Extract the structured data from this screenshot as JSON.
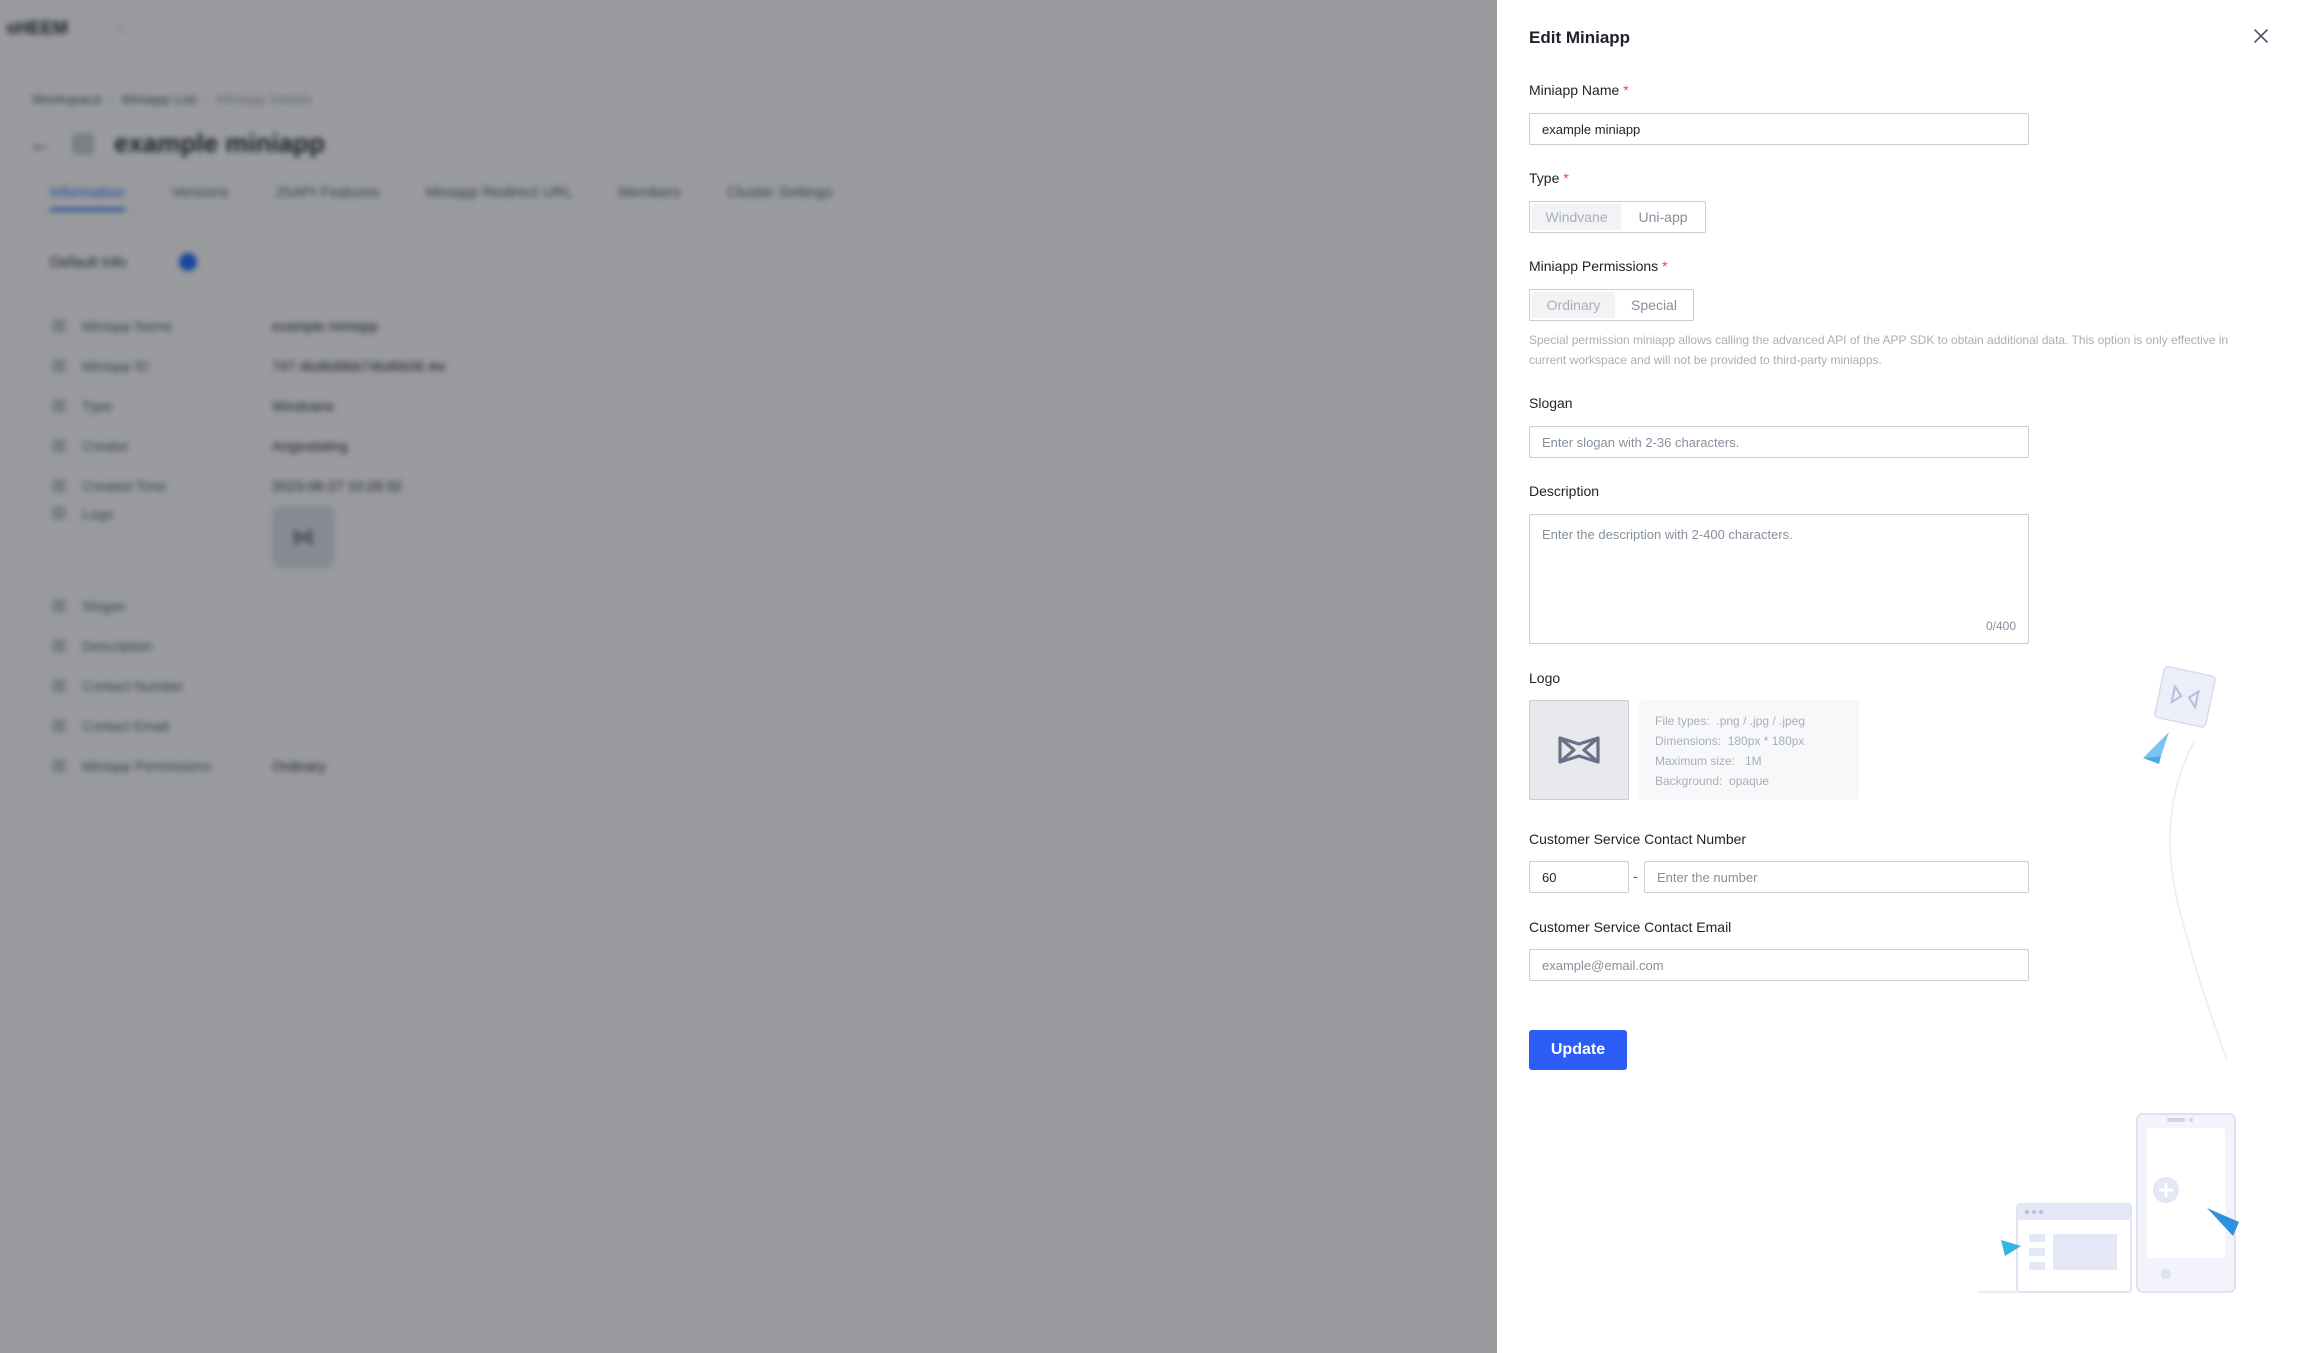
{
  "background": {
    "brand": "sHEEM",
    "breadcrumb": [
      "Workspace",
      "Miniapp List",
      "Miniapp Details"
    ],
    "page_title": "example miniapp",
    "tabs": [
      "Information",
      "Versions",
      "JSAPI Features",
      "Miniapp Redirect URL",
      "Members",
      "Cluster Settings"
    ],
    "section_title": "Default Info",
    "info_rows": [
      {
        "label": "Miniapp Name",
        "value": "example miniapp"
      },
      {
        "label": "Miniapp ID",
        "value": "747.4bd6d8bb74bd6b08.4w"
      },
      {
        "label": "Type",
        "value": "Windvane"
      },
      {
        "label": "Creator",
        "value": "Angewlaling"
      },
      {
        "label": "Created Time",
        "value": "2023-06-27 10:28:32"
      },
      {
        "label": "Logo",
        "value": ""
      },
      {
        "label": "Slogan",
        "value": ""
      },
      {
        "label": "Description",
        "value": ""
      },
      {
        "label": "Contact Number",
        "value": ""
      },
      {
        "label": "Contact Email",
        "value": ""
      },
      {
        "label": "Miniapp Permissions",
        "value": "Ordinary"
      }
    ]
  },
  "drawer": {
    "title": "Edit Miniapp",
    "name_label": "Miniapp Name",
    "name_value": "example miniapp",
    "type_label": "Type",
    "type_options": [
      "Windvane",
      "Uni-app"
    ],
    "type_selected": "Windvane",
    "permissions_label": "Miniapp Permissions",
    "permission_options": [
      "Ordinary",
      "Special"
    ],
    "permission_selected": "Ordinary",
    "permission_hint": "Special permission miniapp allows calling the advanced API of the APP SDK to obtain additional data. This option is only effective in current workspace and will not be provided to third-party miniapps.",
    "slogan_label": "Slogan",
    "slogan_placeholder": "Enter slogan with 2-36 characters.",
    "description_label": "Description",
    "description_placeholder": "Enter the description with 2-400 characters.",
    "description_counter": "0/400",
    "logo_label": "Logo",
    "logo_tips": [
      "File types:  .png / .jpg / .jpeg",
      "Dimensions:  180px * 180px",
      "Maximum size:   1M",
      "Background:  opaque"
    ],
    "phone_label": "Customer Service Contact Number",
    "phone_prefix": "60",
    "phone_separator": "-",
    "phone_placeholder": "Enter the number",
    "email_label": "Customer Service Contact Email",
    "email_placeholder": "example@email.com",
    "update_label": "Update"
  },
  "colors": {
    "primary": "#2b5cf6",
    "required": "#f53f3f",
    "overlay": "rgba(29,33,41,0.45)"
  }
}
